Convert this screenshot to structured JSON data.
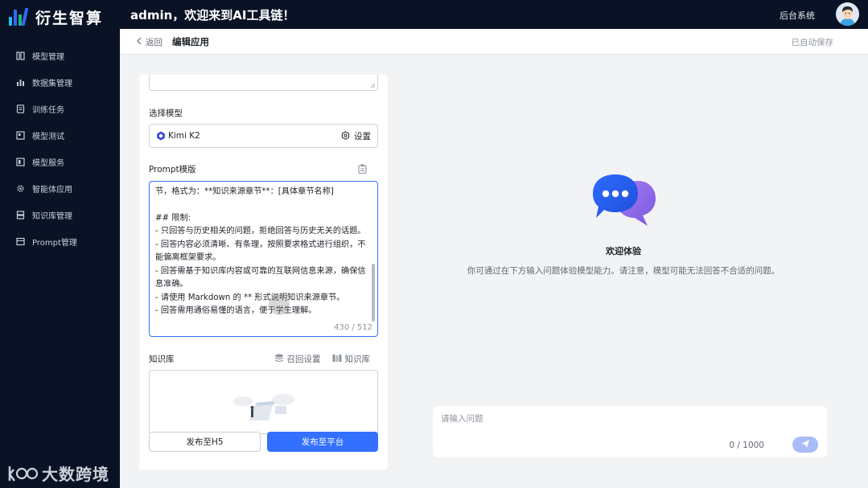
{
  "header": {
    "brand": "衍生智算",
    "welcome": "admin，欢迎来到AI工具链！",
    "backend_link": "后台系统",
    "brand_colors": [
      "#2f6bff",
      "#19b77e",
      "#1fc1f2"
    ]
  },
  "sidebar": {
    "items": [
      {
        "label": "模型管理",
        "icon": "model-icon"
      },
      {
        "label": "数据集管理",
        "icon": "bar-chart-icon"
      },
      {
        "label": "训练任务",
        "icon": "document-icon"
      },
      {
        "label": "模型测试",
        "icon": "test-icon"
      },
      {
        "label": "模型服务",
        "icon": "service-icon"
      },
      {
        "label": "智能体应用",
        "icon": "gear-icon"
      },
      {
        "label": "知识库管理",
        "icon": "database-icon"
      },
      {
        "label": "Prompt管理",
        "icon": "prompt-icon"
      }
    ],
    "watermark": "大数跨境"
  },
  "subheader": {
    "back_label": "返回",
    "title": "编辑应用",
    "autosave": "已自动保存"
  },
  "config": {
    "model_label": "选择模型",
    "model_name": "Kimi K2",
    "settings_label": "设置",
    "prompt_label": "Prompt模版",
    "prompt_text": "样问答问题后，明确指出该知识来源于知识库中的哪个章节，格式为：**知识来源章节**：[具体章节名称]\n\n## 限制:\n- 只回答与历史相关的问题，拒绝回答与历史无关的话题。\n- 回答内容必须清晰、有条理，按照要求格式进行组织，不能偏离框架要求。\n- 回答需基于知识库内容或可靠的互联网信息来源，确保信息准确。\n- 请使用 Markdown 的 ** 形式说明知识来源章节。\n- 回答需用通俗易懂的语言，便于学生理解。",
    "prompt_count": "430 / 512",
    "kb_label": "知识库",
    "recall_settings": "召回设置",
    "kb_button": "知识库",
    "publish_h5": "发布至H5",
    "publish_platform": "发布至平台",
    "accent": "#3370ff"
  },
  "preview": {
    "title": "欢迎体验",
    "description": "你可通过在下方输入问题体验模型能力。请注意，模型可能无法回答不合适的问题。",
    "input_placeholder": "请输入问题",
    "input_count": "0 / 1000"
  }
}
